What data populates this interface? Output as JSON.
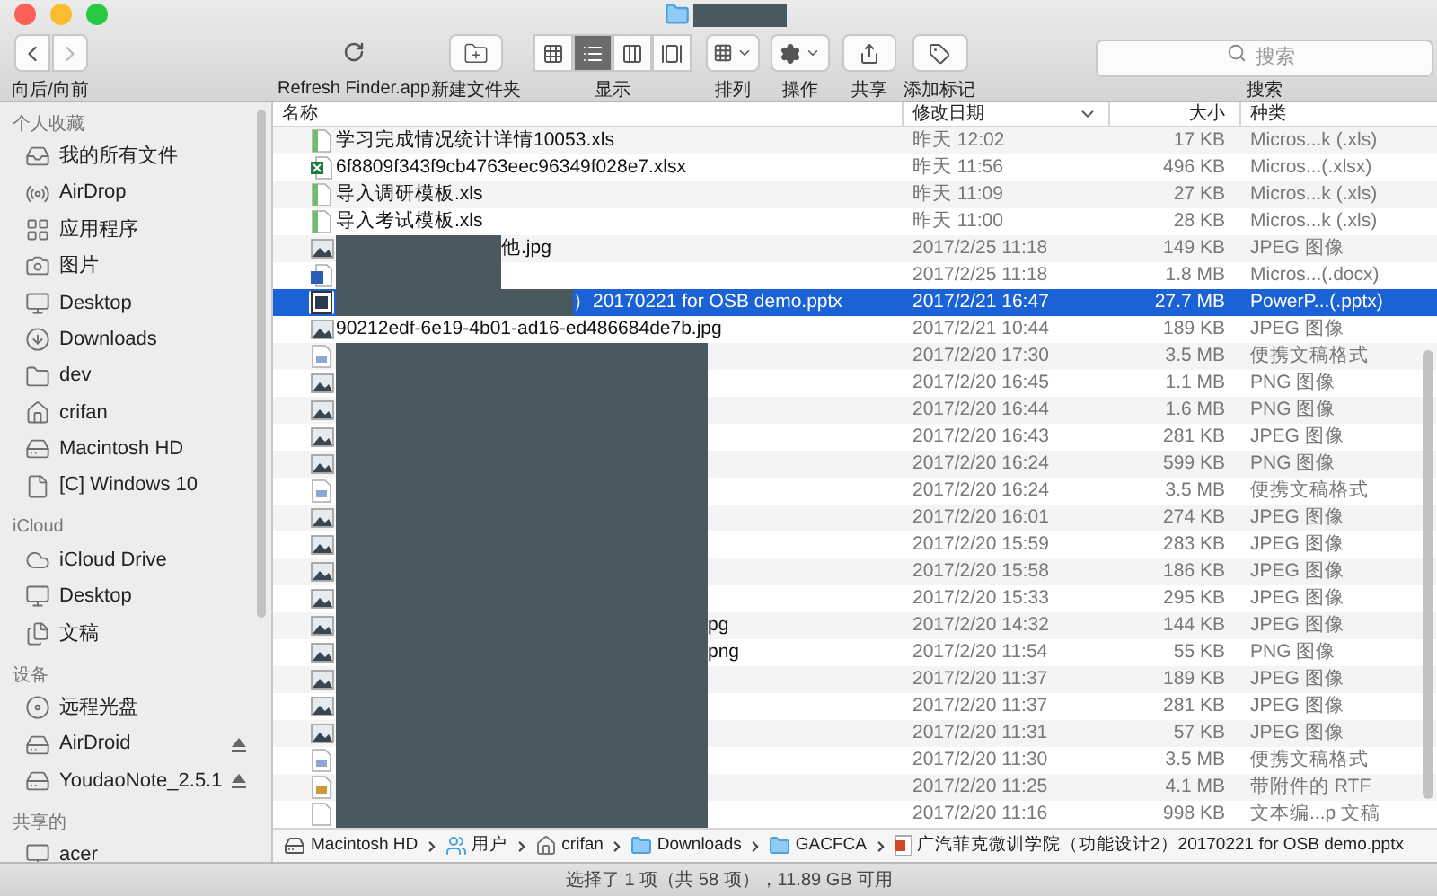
{
  "toolbar": {
    "nav": {
      "label": "向后/向前",
      "back_disabled": false,
      "forward_disabled": true
    },
    "refresh": {
      "label": "Refresh Finder.app"
    },
    "new_folder": {
      "label": "新建文件夹"
    },
    "views": {
      "label": "显示",
      "options": [
        {
          "kind": "icon",
          "selected": false
        },
        {
          "kind": "list",
          "selected": true
        },
        {
          "kind": "column",
          "selected": false
        },
        {
          "kind": "cover",
          "selected": false
        }
      ]
    },
    "arrange": {
      "label": "排列"
    },
    "action": {
      "label": "操作"
    },
    "share": {
      "label": "共享"
    },
    "tag": {
      "label": "添加标记"
    },
    "search": {
      "placeholder": "搜索",
      "label": "搜索"
    }
  },
  "sidebar": {
    "sections": [
      {
        "title": "个人收藏",
        "items": [
          {
            "label": "我的所有文件",
            "kind": "allfiles",
            "eject": false
          },
          {
            "label": "AirDrop",
            "kind": "airdrop",
            "eject": false
          },
          {
            "label": "应用程序",
            "kind": "apps",
            "eject": false
          },
          {
            "label": "图片",
            "kind": "pictures",
            "eject": false
          },
          {
            "label": "Desktop",
            "kind": "desktop",
            "eject": false
          },
          {
            "label": "Downloads",
            "kind": "downloads",
            "eject": false
          },
          {
            "label": "dev",
            "kind": "folder",
            "eject": false
          },
          {
            "label": "crifan",
            "kind": "home",
            "eject": false
          },
          {
            "label": "Macintosh HD",
            "kind": "disk",
            "eject": false
          },
          {
            "label": "[C] Windows 10",
            "kind": "document",
            "eject": false
          }
        ]
      },
      {
        "title": "iCloud",
        "items": [
          {
            "label": "iCloud Drive",
            "kind": "cloud",
            "eject": false
          },
          {
            "label": "Desktop",
            "kind": "desktop",
            "eject": false
          },
          {
            "label": "文稿",
            "kind": "docs",
            "eject": false
          }
        ]
      },
      {
        "title": "设备",
        "items": [
          {
            "label": "远程光盘",
            "kind": "disc",
            "eject": false
          },
          {
            "label": "AirDroid",
            "kind": "drive",
            "eject": true
          },
          {
            "label": "YoudaoNote_2.5.1",
            "kind": "drive",
            "eject": true
          }
        ]
      },
      {
        "title": "共享的",
        "items": [
          {
            "label": "acer",
            "kind": "computer",
            "eject": false
          }
        ]
      }
    ]
  },
  "table": {
    "columns": [
      {
        "label": "名称",
        "sorted": false
      },
      {
        "label": "修改日期",
        "sorted": true
      },
      {
        "label": "大小",
        "sorted": false
      },
      {
        "label": "种类",
        "sorted": false
      }
    ],
    "rows": [
      {
        "name": "学习完成情况统计详情10053.xls",
        "date": "昨天 12:02",
        "size": "17 KB",
        "type": "Micros...k (.xls)",
        "kind": "xls",
        "redacted": false,
        "selected": false
      },
      {
        "name": "6f8809f343f9cb4763eec96349f028e7.xlsx",
        "date": "昨天 11:56",
        "size": "496 KB",
        "type": "Micros...(.xlsx)",
        "kind": "xlsx",
        "redacted": false,
        "selected": false
      },
      {
        "name": "导入调研模板.xls",
        "date": "昨天 11:09",
        "size": "27 KB",
        "type": "Micros...k (.xls)",
        "kind": "xls",
        "redacted": false,
        "selected": false
      },
      {
        "name": "导入考试模板.xls",
        "date": "昨天 11:00",
        "size": "28 KB",
        "type": "Micros...k (.xls)",
        "kind": "xls",
        "redacted": false,
        "selected": false
      },
      {
        "name": "他.jpg",
        "date": "2017/2/25 11:18",
        "size": "149 KB",
        "type": "JPEG 图像",
        "kind": "image",
        "redacted": true,
        "selected": false
      },
      {
        "date": "2017/2/25 11:18",
        "size": "1.8 MB",
        "type": "Micros...(.docx)",
        "kind": "docx",
        "redacted": true,
        "selected": false
      },
      {
        "name": "）20170221 for OSB demo.pptx",
        "date": "2017/2/21 16:47",
        "size": "27.7 MB",
        "type": "PowerP...(.pptx)",
        "kind": "pptx",
        "redacted": true,
        "selected": true
      },
      {
        "name": "90212edf-6e19-4b01-ad16-ed486684de7b.jpg",
        "date": "2017/2/21 10:44",
        "size": "189 KB",
        "type": "JPEG 图像",
        "kind": "image",
        "redacted": false,
        "selected": false
      },
      {
        "date": "2017/2/20 17:30",
        "size": "3.5 MB",
        "type": "便携文稿格式",
        "kind": "pdf",
        "redacted": true,
        "selected": false
      },
      {
        "date": "2017/2/20 16:45",
        "size": "1.1 MB",
        "type": "PNG 图像",
        "kind": "image",
        "redacted": true,
        "selected": false
      },
      {
        "date": "2017/2/20 16:44",
        "size": "1.6 MB",
        "type": "PNG 图像",
        "kind": "image",
        "redacted": true,
        "selected": false
      },
      {
        "date": "2017/2/20 16:43",
        "size": "281 KB",
        "type": "JPEG 图像",
        "kind": "image",
        "redacted": true,
        "selected": false
      },
      {
        "date": "2017/2/20 16:24",
        "size": "599 KB",
        "type": "PNG 图像",
        "kind": "image",
        "redacted": true,
        "selected": false
      },
      {
        "date": "2017/2/20 16:24",
        "size": "3.5 MB",
        "type": "便携文稿格式",
        "kind": "pdf",
        "redacted": true,
        "selected": false
      },
      {
        "date": "2017/2/20 16:01",
        "size": "274 KB",
        "type": "JPEG 图像",
        "kind": "image",
        "redacted": true,
        "selected": false
      },
      {
        "date": "2017/2/20 15:59",
        "size": "283 KB",
        "type": "JPEG 图像",
        "kind": "image",
        "redacted": true,
        "selected": false
      },
      {
        "date": "2017/2/20 15:58",
        "size": "186 KB",
        "type": "JPEG 图像",
        "kind": "image",
        "redacted": true,
        "selected": false
      },
      {
        "date": "2017/2/20 15:33",
        "size": "295 KB",
        "type": "JPEG 图像",
        "kind": "image",
        "redacted": true,
        "selected": false
      },
      {
        "name": "pg",
        "date": "2017/2/20 14:32",
        "size": "144 KB",
        "type": "JPEG 图像",
        "kind": "image",
        "redacted": true,
        "selected": false
      },
      {
        "name": "png",
        "date": "2017/2/20 11:54",
        "size": "55 KB",
        "type": "PNG 图像",
        "kind": "image",
        "redacted": true,
        "selected": false
      },
      {
        "date": "2017/2/20 11:37",
        "size": "189 KB",
        "type": "JPEG 图像",
        "kind": "image",
        "redacted": true,
        "selected": false
      },
      {
        "date": "2017/2/20 11:37",
        "size": "281 KB",
        "type": "JPEG 图像",
        "kind": "image",
        "redacted": true,
        "selected": false
      },
      {
        "date": "2017/2/20 11:31",
        "size": "57 KB",
        "type": "JPEG 图像",
        "kind": "image",
        "redacted": true,
        "selected": false
      },
      {
        "date": "2017/2/20 11:30",
        "size": "3.5 MB",
        "type": "便携文稿格式",
        "kind": "pdf",
        "redacted": true,
        "selected": false
      },
      {
        "date": "2017/2/20 11:25",
        "size": "4.1 MB",
        "type": "带附件的 RTF",
        "kind": "rtf",
        "redacted": true,
        "selected": false
      },
      {
        "date": "2017/2/20 11:16",
        "size": "998 KB",
        "type": "文本编...p 文稿",
        "kind": "txt",
        "redacted": true,
        "selected": false
      }
    ]
  },
  "path_bar": [
    {
      "label": "Macintosh HD",
      "kind": "disk"
    },
    {
      "label": "用户",
      "kind": "users"
    },
    {
      "label": "crifan",
      "kind": "home"
    },
    {
      "label": "Downloads",
      "kind": "downloads"
    },
    {
      "label": "GACFCA",
      "kind": "folder"
    },
    {
      "label": "广汽菲克微训学院（功能设计2）20170221 for OSB demo.pptx",
      "kind": "pptx"
    }
  ],
  "status_bar": "选择了 1 项（共 58 项），11.89 GB 可用"
}
